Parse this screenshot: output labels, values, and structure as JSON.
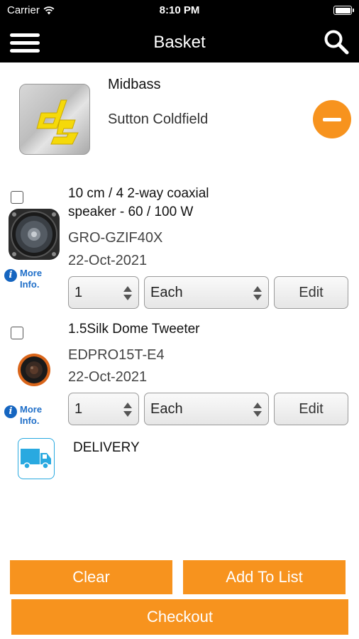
{
  "status_bar": {
    "carrier": "Carrier",
    "time": "8:10 PM"
  },
  "nav": {
    "title": "Basket"
  },
  "store": {
    "name": "Midbass",
    "location": "Sutton Coldfield"
  },
  "items": [
    {
      "title_line1": "10 cm / 4 2-way coaxial",
      "title_line2": "speaker - 60 / 100 W",
      "sku": "GRO-GZIF40X",
      "date": "22-Oct-2021",
      "more_info_line1": "More",
      "more_info_line2": "Info.",
      "quantity": "1",
      "unit": "Each",
      "edit_label": "Edit"
    },
    {
      "title_line1": "1.5Silk Dome Tweeter",
      "title_line2": "",
      "sku": "EDPRO15T-E4",
      "date": "22-Oct-2021",
      "more_info_line1": "More",
      "more_info_line2": "Info.",
      "quantity": "1",
      "unit": "Each",
      "edit_label": "Edit"
    }
  ],
  "delivery": {
    "label": "DELIVERY"
  },
  "actions": {
    "clear": "Clear",
    "add_to_list": "Add To List",
    "checkout": "Checkout"
  },
  "colors": {
    "accent": "#f7931e",
    "nav_bg": "#000000",
    "info_blue": "#1e6ec8",
    "truck_blue": "#29a9e0"
  }
}
